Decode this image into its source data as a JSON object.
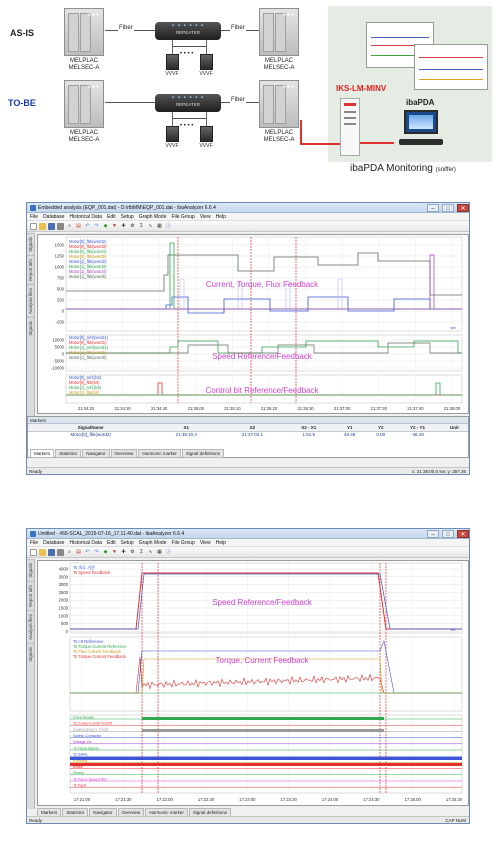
{
  "diagram": {
    "asis_label": "AS-IS",
    "tobe_label": "TO-BE",
    "fiber": "Fiber",
    "repeater": "REPEATER",
    "cabinet_line1": "MELPLAC",
    "cabinet_line2": "MELSEC-A",
    "vvvf": "VVVF",
    "ellipsis": "• • • •",
    "iks_label": "IKS-LM-MINV",
    "ibapda_label": "ibaPDA",
    "monitoring_label": "ibaPDA Monitoring",
    "monitoring_sub": "(sniffer)"
  },
  "window1": {
    "title": "Embedded analysis (EQP_001.dat) - D:\\rtbMM\\EQP_001.dat - ibaAnalyzer 6.6.4",
    "menu": [
      "File",
      "Database",
      "Historical Data",
      "Edit",
      "Setup",
      "Graph Mode",
      "File Group",
      "View",
      "Help"
    ],
    "side_tabs": [
      "Signals",
      "Report info",
      "Analysis files",
      "Signals"
    ],
    "plot1_legend": [
      "Motor[0]_fbk(word2)",
      "Motor[0]_fbk(word3)",
      "Motor[0]_fbk(word4)",
      "Motor[0]_fbk(word5)",
      "Motor[1]_fbk(word2)",
      "Motor[1]_fbk(word3)",
      "Motor[1]_fbk(word4)",
      "Motor[1]_fbk(word5)"
    ],
    "plot2_legend": [
      "Motor[0]_ref2(word1)",
      "Motor[0]_fbk(word1)",
      "Motor[1]_ref2(word1)",
      "Motor[1]_fbk(word1)",
      "Motor[1]_fbk(word0)"
    ],
    "plot3_legend": [
      "Motor[0]_ref1(bit)",
      "Motor[0]_fbk(bit)",
      "Motor[1]_ref1(bit)",
      "Motor[1]_fbk(bit)"
    ],
    "plot1_ticks": [
      "1500",
      "1250",
      "1000",
      "750",
      "500",
      "250",
      "0",
      "-250"
    ],
    "plot2_ticks": [
      "10000",
      "5000",
      "0",
      "-5000",
      "-10000"
    ],
    "plot1_caption": "Current, Torque, Flux Feedback",
    "plot2_caption": "Speed Reference/Feedback",
    "plot3_caption": "Control bit Reference/Feedback",
    "time_ticks": [
      "21:34:20",
      "21:34:30",
      "21:34:40",
      "21:35:00",
      "21:35:10",
      "21:35:20",
      "21:35:30",
      "21:37:00",
      "21:37:30",
      "21:37:40",
      "21:38:00"
    ],
    "unit_tag": "sec",
    "markers_title": "Markers",
    "markers_headers": [
      "SignalName",
      "X1",
      "X2",
      "X2 - X1",
      "Y1",
      "Y2",
      "Y2 - Y1",
      "Unit"
    ],
    "markers_row": [
      "Motor[0]_fbk(word2)",
      "21:35:10.4",
      "21:37:02.1",
      "1:51:6",
      "46.48",
      "0.00",
      "-46.48",
      ""
    ],
    "bottom_tabs": [
      "Markers",
      "Statistics",
      "Navigator",
      "Overview",
      "Harmonic marker",
      "Signal definitions"
    ],
    "status_left": "Ready",
    "status_right": "x: 21:38:00.0 sec   y: 357.36",
    "status_far": ""
  },
  "window2": {
    "title": "Untitled - #66-SCAL_2015-07-16_17.11.40.dat - ibaAnalyzer 6.6.4",
    "menu": [
      "File",
      "Database",
      "Historical Data",
      "Edit",
      "Setup",
      "Graph Mode",
      "File Group",
      "View",
      "Help"
    ],
    "side_tabs": [
      "Signals",
      "Report info",
      "Analysis files",
      "Signals"
    ],
    "plot1_legend": [
      "Ts 속도 기준",
      "Ts Speed Feedback"
    ],
    "plot2_legend": [
      "Ts I.8 Reference",
      "Ts Torque Current Reference",
      "Ts Flux Current Feedback",
      "Ts Torque Current Feedback"
    ],
    "plot1_ticks": [
      "4000",
      "3500",
      "3000",
      "2500",
      "2000",
      "1500",
      "1000",
      "500",
      "0"
    ],
    "plot1_caption": "Speed Reference/Feedback",
    "plot2_caption": "Torque, Current Feedback",
    "digital_labels": [
      "Drive Ready",
      "Ts Current Limit On/Off",
      "EMERGENCY STOP",
      "Safety Contactor",
      "Voltage Ok",
      "Ts Hoop Signal",
      "Ts SAFE",
      "Running",
      "Brake",
      "Ready",
      "Ts Force Speed Ref",
      "Ts Fault"
    ],
    "time_ticks": [
      "17:21:00",
      "17:21:30",
      "17:22:00",
      "17:22:30",
      "17:23:00",
      "17:23:30",
      "17:24:00",
      "17:24:30",
      "17:25:00",
      "17:25:30"
    ],
    "unit_tag": "sec",
    "bottom_tabs": [
      "Markers",
      "Statistics",
      "Navigator",
      "Overview",
      "Harmonic marker",
      "Signal definitions"
    ],
    "status_left": "Ready",
    "status_right": "CAP  NUM"
  }
}
